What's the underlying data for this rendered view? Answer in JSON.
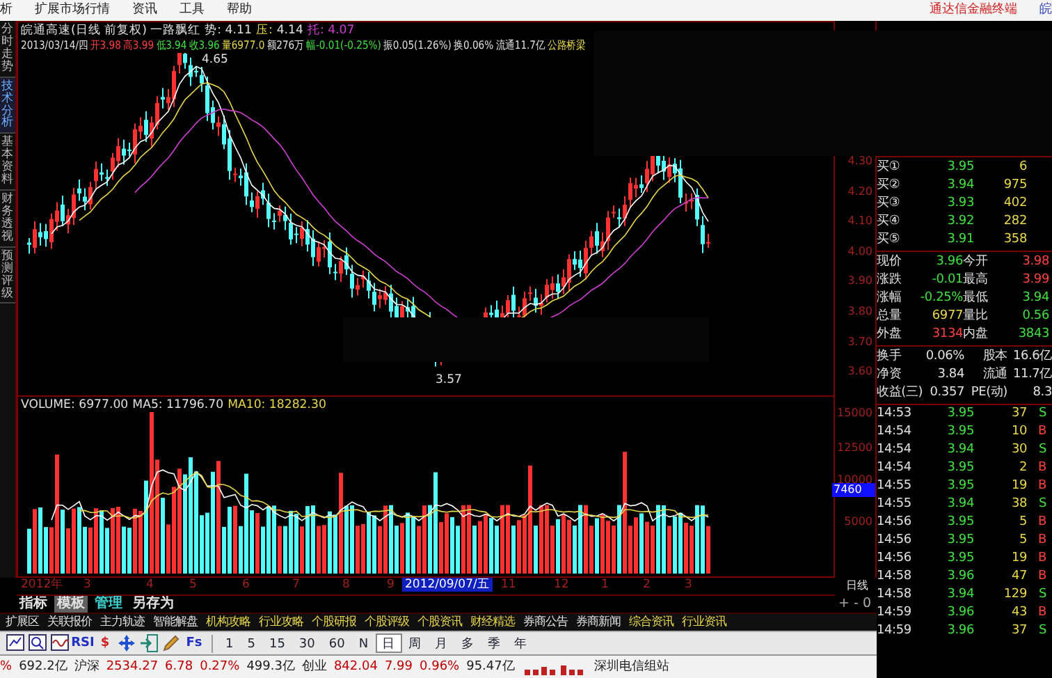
{
  "menu": {
    "items": [
      "析",
      "扩展市场行情",
      "资讯",
      "工具",
      "帮助"
    ],
    "brand": "通达信金融终端",
    "brand_cut": "皖"
  },
  "side_tabs": [
    {
      "label": "分时走势",
      "selected": false
    },
    {
      "label": "技术分析",
      "selected": true
    },
    {
      "label": "基本资料",
      "selected": false
    },
    {
      "label": "财务透视",
      "selected": false
    },
    {
      "label": "预测评级",
      "selected": false
    }
  ],
  "chart": {
    "header_lines": [
      [
        {
          "text": "皖通高速(日线 前复权) 一路飘红",
          "color": "#e0e0e0"
        },
        {
          "text": "势: 4.11",
          "color": "#e0e0e0"
        },
        {
          "text": "压:",
          "color": "#e8d84a"
        },
        {
          "text": "4.14",
          "color": "#e0e0e0"
        },
        {
          "text": "托: 4.07",
          "color": "#d040d0"
        }
      ],
      [
        {
          "text": "2013/03/14/四",
          "color": "#e0e0e0"
        },
        {
          "text": "开3.98",
          "color": "#ff4040"
        },
        {
          "text": "高3.99",
          "color": "#ff4040"
        },
        {
          "text": "低3.94",
          "color": "#40e040"
        },
        {
          "text": "收3.96",
          "color": "#40e040"
        },
        {
          "text": "量6977.0",
          "color": "#e8d84a"
        },
        {
          "text": "额276万",
          "color": "#e0e0e0"
        },
        {
          "text": "幅-0.01(-0.25%)",
          "color": "#40e040"
        },
        {
          "text": "振0.05(1.26%)",
          "color": "#e0e0e0"
        },
        {
          "text": "换0.06%",
          "color": "#e0e0e0"
        },
        {
          "text": "流通11.7亿",
          "color": "#e0e0e0"
        },
        {
          "text": "公路桥梁",
          "color": "#e8d84a"
        }
      ]
    ],
    "high_label": "4.65",
    "low_label": "3.57",
    "price_axis": [
      "4.30",
      "4.20",
      "4.10",
      "4.00",
      "3.90",
      "3.80",
      "3.70",
      "3.60"
    ]
  },
  "volume": {
    "header": [
      {
        "text": "VOLUME: 6977.00",
        "color": "#e0e0e0"
      },
      {
        "text": "MA5: 11796.70",
        "color": "#e0e0e0"
      },
      {
        "text": "MA10: 18282.30",
        "color": "#e8d84a"
      }
    ],
    "axis": [
      {
        "label": "15000",
        "selected": false
      },
      {
        "label": "12500",
        "selected": false
      },
      {
        "label": "10000",
        "selected": false
      },
      {
        "label": "7460",
        "selected": true
      },
      {
        "label": "5000",
        "selected": false
      }
    ]
  },
  "date_axis": [
    {
      "label": "2012年",
      "selected": false
    },
    {
      "label": "3",
      "selected": false
    },
    {
      "label": "4",
      "selected": false
    },
    {
      "label": "5",
      "selected": false
    },
    {
      "label": "6",
      "selected": false
    },
    {
      "label": "7",
      "selected": false
    },
    {
      "label": "8",
      "selected": false
    },
    {
      "label": "9",
      "selected": false
    },
    {
      "label": "2012/09/07/五",
      "selected": true
    },
    {
      "label": "11",
      "selected": false
    },
    {
      "label": "12",
      "selected": false
    },
    {
      "label": "1",
      "selected": false
    },
    {
      "label": "2",
      "selected": false
    },
    {
      "label": "3",
      "selected": false
    }
  ],
  "period_label": "日线",
  "right_panel": {
    "bids": [
      {
        "label": "买①",
        "price": "3.95",
        "volume": "6"
      },
      {
        "label": "买②",
        "price": "3.94",
        "volume": "975"
      },
      {
        "label": "买③",
        "price": "3.93",
        "volume": "402"
      },
      {
        "label": "买④",
        "price": "3.92",
        "volume": "282"
      },
      {
        "label": "买⑤",
        "price": "3.91",
        "volume": "358"
      }
    ],
    "quotes": [
      {
        "cells": [
          {
            "label": "现价",
            "value": "3.96",
            "color": "#40e040"
          },
          {
            "label": "今开",
            "value": "3.98",
            "color": "#ff4040"
          }
        ]
      },
      {
        "cells": [
          {
            "label": "涨跌",
            "value": "-0.01",
            "color": "#40e040"
          },
          {
            "label": "最高",
            "value": "3.99",
            "color": "#ff4040"
          }
        ]
      },
      {
        "cells": [
          {
            "label": "涨幅",
            "value": "-0.25%",
            "color": "#40e040"
          },
          {
            "label": "最低",
            "value": "3.94",
            "color": "#40e040"
          }
        ]
      },
      {
        "cells": [
          {
            "label": "总量",
            "value": "6977",
            "color": "#e8d84a"
          },
          {
            "label": "量比",
            "value": "0.56",
            "color": "#40e040"
          }
        ]
      },
      {
        "cells": [
          {
            "label": "外盘",
            "value": "3134",
            "color": "#ff4040"
          },
          {
            "label": "内盘",
            "value": "3843",
            "color": "#40e040"
          }
        ]
      }
    ],
    "stats": [
      {
        "label": "换手",
        "value": "0.06%",
        "label2": "股本",
        "value2": "16.6亿"
      },
      {
        "label": "净资",
        "value": "3.84",
        "label2": "流通",
        "value2": "11.7亿"
      },
      {
        "label": "收益(三)",
        "value": "0.357",
        "label2": "PE(动)",
        "value2": "8.3"
      }
    ],
    "ticks": [
      {
        "time": "14:53",
        "price": "3.95",
        "volume": "37",
        "side": "S",
        "color": "#40e040"
      },
      {
        "time": "14:54",
        "price": "3.95",
        "volume": "10",
        "side": "B",
        "color": "#ff4040"
      },
      {
        "time": "14:54",
        "price": "3.94",
        "volume": "30",
        "side": "S",
        "color": "#40e040"
      },
      {
        "time": "14:54",
        "price": "3.95",
        "volume": "2",
        "side": "B",
        "color": "#ff4040"
      },
      {
        "time": "14:55",
        "price": "3.95",
        "volume": "19",
        "side": "B",
        "color": "#ff4040"
      },
      {
        "time": "14:55",
        "price": "3.94",
        "volume": "38",
        "side": "S",
        "color": "#40e040"
      },
      {
        "time": "14:56",
        "price": "3.95",
        "volume": "5",
        "side": "B",
        "color": "#ff4040"
      },
      {
        "time": "14:56",
        "price": "3.95",
        "volume": "5",
        "side": "B",
        "color": "#ff4040"
      },
      {
        "time": "14:56",
        "price": "3.95",
        "volume": "19",
        "side": "B",
        "color": "#ff4040"
      },
      {
        "time": "14:58",
        "price": "3.96",
        "volume": "47",
        "side": "B",
        "color": "#ff4040"
      },
      {
        "time": "14:58",
        "price": "3.94",
        "volume": "129",
        "side": "S",
        "color": "#40e040"
      },
      {
        "time": "14:59",
        "price": "3.96",
        "volume": "43",
        "side": "B",
        "color": "#ff4040"
      },
      {
        "time": "14:59",
        "price": "3.96",
        "volume": "37",
        "side": "S",
        "color": "#40e040"
      }
    ]
  },
  "indicator_bar": {
    "tabs": [
      {
        "label": "指标",
        "selected": false,
        "color": "#e0e0e0"
      },
      {
        "label": "模板",
        "selected": true,
        "color": "#e0e0e0"
      },
      {
        "label": "管理",
        "selected": false,
        "color": "#40d0d0"
      },
      {
        "label": "另存为",
        "selected": false,
        "color": "#e0e0e0"
      }
    ],
    "zoom_controls": "+ - 0"
  },
  "link_bar": [
    {
      "label": "扩展区",
      "color": "#e0e0e0"
    },
    {
      "label": "关联报价",
      "color": "#e0e0e0"
    },
    {
      "label": "主力轨迹",
      "color": "#e0e0e0"
    },
    {
      "label": "智能解盘",
      "color": "#e0e0e0"
    },
    {
      "label": "机构攻略",
      "color": "#e8d84a"
    },
    {
      "label": "行业攻略",
      "color": "#e8d84a"
    },
    {
      "label": "个股研报",
      "color": "#e8d84a"
    },
    {
      "label": "个股评级",
      "color": "#e8d84a"
    },
    {
      "label": "个股资讯",
      "color": "#e8d84a"
    },
    {
      "label": "财经精选",
      "color": "#e8d84a"
    },
    {
      "label": "券商公告",
      "color": "#e0e0e0"
    },
    {
      "label": "券商新闻",
      "color": "#e0e0e0"
    },
    {
      "label": "综合资讯",
      "color": "#e8d84a"
    },
    {
      "label": "行业资讯",
      "color": "#e8d84a"
    }
  ],
  "toolbar": {
    "tools": [
      {
        "kind": "chart"
      },
      {
        "kind": "zoom"
      },
      {
        "kind": "wave"
      },
      {
        "kind": "text",
        "text": "RSI",
        "color": "#2030c0"
      },
      {
        "kind": "text",
        "text": "$",
        "color": "#d02020"
      },
      {
        "kind": "move"
      },
      {
        "kind": "exit"
      },
      {
        "kind": "pencil"
      },
      {
        "kind": "text",
        "text": "Fs",
        "color": "#2030c0"
      }
    ],
    "periods": [
      {
        "label": "1",
        "selected": false
      },
      {
        "label": "5",
        "selected": false
      },
      {
        "label": "15",
        "selected": false
      },
      {
        "label": "30",
        "selected": false
      },
      {
        "label": "60",
        "selected": false
      },
      {
        "label": "N",
        "selected": false
      },
      {
        "label": "日",
        "selected": true
      },
      {
        "label": "周",
        "selected": false
      },
      {
        "label": "月",
        "selected": false
      },
      {
        "label": "多",
        "selected": false
      },
      {
        "label": "季",
        "selected": false
      },
      {
        "label": "年",
        "selected": false
      }
    ]
  },
  "status_bar": {
    "items": [
      {
        "text": "%",
        "color": "#c00000"
      },
      {
        "text": "692.2亿",
        "color": "#202020"
      },
      {
        "text": "沪深",
        "color": "#202020"
      },
      {
        "text": "2534.27",
        "color": "#c00000"
      },
      {
        "text": "6.78",
        "color": "#c00000"
      },
      {
        "text": "0.27%",
        "color": "#c00000"
      },
      {
        "text": "499.3亿",
        "color": "#202020"
      },
      {
        "text": "创业",
        "color": "#202020"
      },
      {
        "text": "842.04",
        "color": "#c00000"
      },
      {
        "text": "7.99",
        "color": "#c00000"
      },
      {
        "text": "0.96%",
        "color": "#c00000"
      },
      {
        "text": "95.47亿",
        "color": "#202020"
      }
    ],
    "server": "深圳电信组站"
  }
}
